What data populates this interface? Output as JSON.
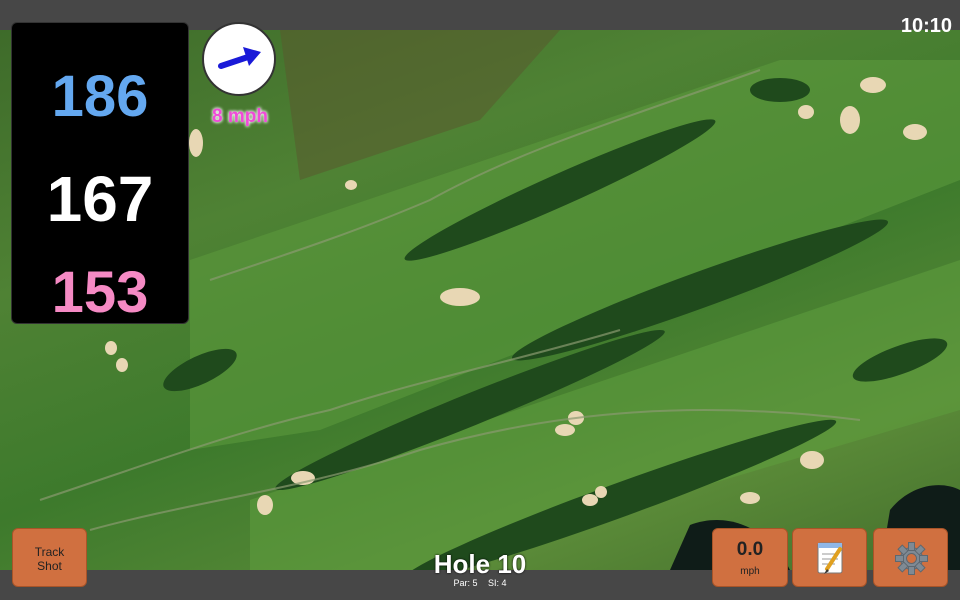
{
  "status": {
    "time": "10:10"
  },
  "distances": {
    "back": "186",
    "middle": "167",
    "front": "153"
  },
  "wind": {
    "speed_label": "8 mph",
    "arrow_icon": "wind-direction-arrow-icon"
  },
  "hole": {
    "title": "Hole 10",
    "par": "Par: 5",
    "si": "SI: 4"
  },
  "buttons": {
    "track_line1": "Track",
    "track_line2": "Shot",
    "speed_value": "0.0",
    "speed_unit": "mph",
    "notes_icon": "notepad-icon",
    "settings_icon": "gear-icon"
  },
  "colors": {
    "back": "#64a8f0",
    "middle": "#ffffff",
    "front": "#f58ac4",
    "wind_text": "#f04ad8",
    "button": "#d07040"
  }
}
